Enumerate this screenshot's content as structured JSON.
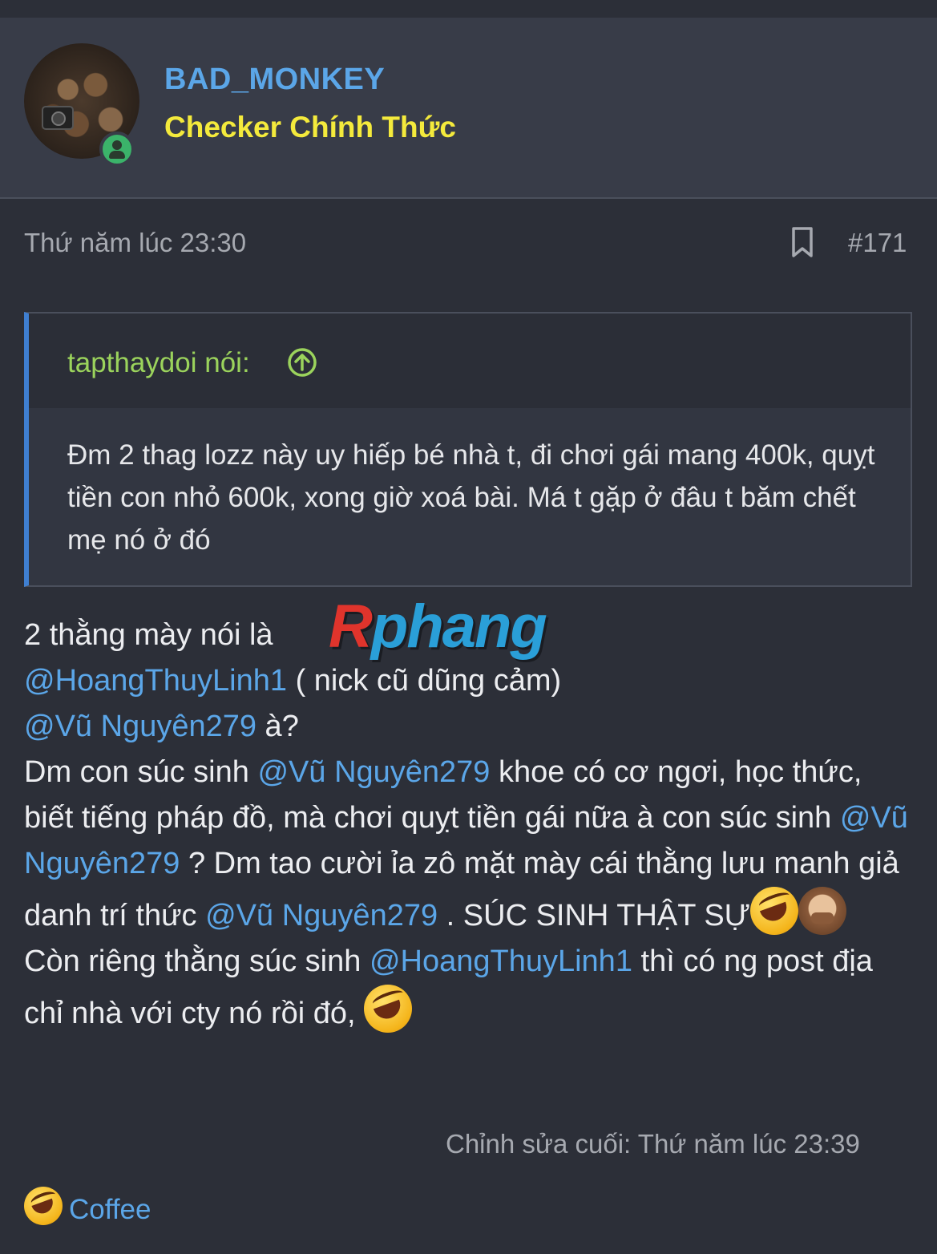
{
  "user": {
    "name": "BAD_MONKEY",
    "title": "Checker Chính Thức"
  },
  "post": {
    "timestamp": "Thứ năm lúc 23:30",
    "number": "#171",
    "quote": {
      "author": "tapthaydoi nói:",
      "body": "Đm 2 thag lozz này uy hiếp bé nhà t, đi chơi gái mang 400k, quỵt tiền con nhỏ 600k, xong giờ xoá bài. Má t gặp ở đâu t băm chết mẹ nó ở đó"
    },
    "watermark": {
      "r": "R",
      "rest": "phang"
    },
    "content": {
      "l1": "2 thằng mày nói là",
      "m1": "@HoangThuyLinh1",
      "t1": " ( nick cũ dũng cảm)",
      "m2": "@Vũ Nguyên279",
      "t2": " à?",
      "t3": "Dm con súc sinh ",
      "m3": "@Vũ Nguyên279",
      "t4": " khoe có cơ ngơi, học thức, biết tiếng pháp đồ, mà chơi quỵt tiền gái nữa à con súc sinh ",
      "m4": "@Vũ Nguyên279",
      "t5": " ? Dm tao cười ỉa zô mặt mày cái thằng lưu manh giả danh trí thức ",
      "m5": "@Vũ Nguyên279",
      "t6": " . SÚC SINH THẬT SỰ",
      "t7": "Còn riêng thằng súc sinh ",
      "m6": "@HoangThuyLinh1",
      "t8": " thì có ng post địa chỉ nhà với cty nó rồi đó, "
    },
    "edited": "Chỉnh sửa cuối: Thứ năm lúc 23:39",
    "reaction_label": "Coffee"
  },
  "icons": {
    "bookmark": "bookmark-icon",
    "quote_jump": "arrow-up-circle-icon",
    "online": "online-user-icon",
    "emoji_laugh": "rolling-laughing-emoji",
    "emoji_monkey": "see-no-evil-monkey-emoji"
  },
  "colors": {
    "background": "#2c2f38",
    "username": "#5ba6e8",
    "user_title": "#f4ea3c",
    "quote_author": "#9bd35c",
    "mention": "#5ba6e8",
    "quote_border": "#3f7fd1"
  }
}
